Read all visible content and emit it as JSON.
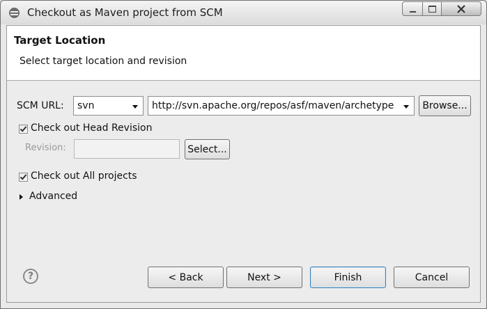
{
  "window": {
    "title": "Checkout as Maven project from SCM",
    "icon": "eclipse-icon"
  },
  "header": {
    "title": "Target Location",
    "description": "Select target location and revision"
  },
  "form": {
    "scm_url_label": "SCM URL:",
    "scm_type_value": "svn",
    "scm_url_value": "http://svn.apache.org/repos/asf/maven/archetype",
    "browse_label": "Browse...",
    "head_revision_label": "Check out Head Revision",
    "head_revision_checked": true,
    "revision_label": "Revision:",
    "revision_value": "",
    "select_label": "Select...",
    "all_projects_label": "Check out All projects",
    "all_projects_checked": true,
    "advanced_label": "Advanced"
  },
  "footer": {
    "help_icon_glyph": "?",
    "back_label": "< Back",
    "next_label": "Next >",
    "finish_label": "Finish",
    "cancel_label": "Cancel"
  }
}
